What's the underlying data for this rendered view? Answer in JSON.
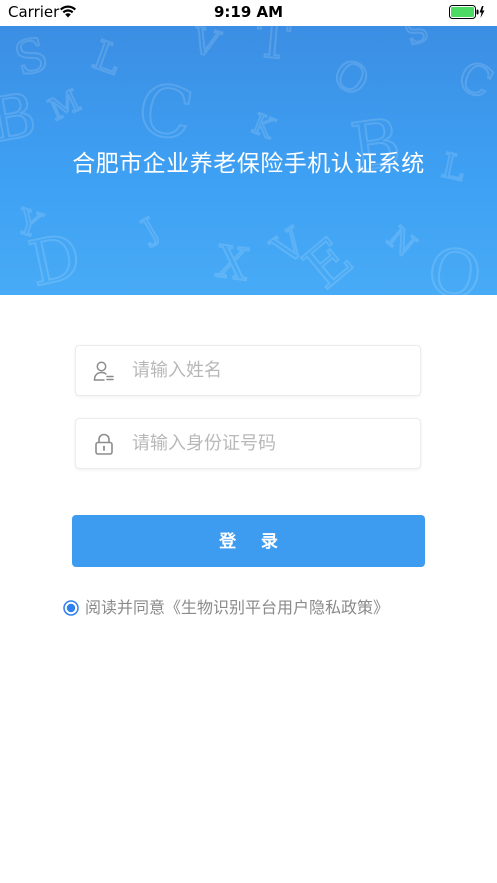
{
  "status_bar": {
    "carrier": "Carrier",
    "time": "9:19 AM",
    "battery_icon": "battery-full-charging-icon",
    "wifi_icon": "wifi-icon"
  },
  "header": {
    "title": "合肥市企业养老保险手机认证系统",
    "background_color": "#3ea0f3"
  },
  "form": {
    "name_placeholder": "请输入姓名",
    "id_placeholder": "请输入身份证号码",
    "name_icon": "user-icon",
    "id_icon": "lock-icon",
    "login_label": "登 录",
    "button_color": "#3d9bf0"
  },
  "agreement": {
    "text": "阅读并同意",
    "link": "《生物识别平台用户隐私政策》",
    "checked": true,
    "accent_color": "#2f80ed"
  }
}
